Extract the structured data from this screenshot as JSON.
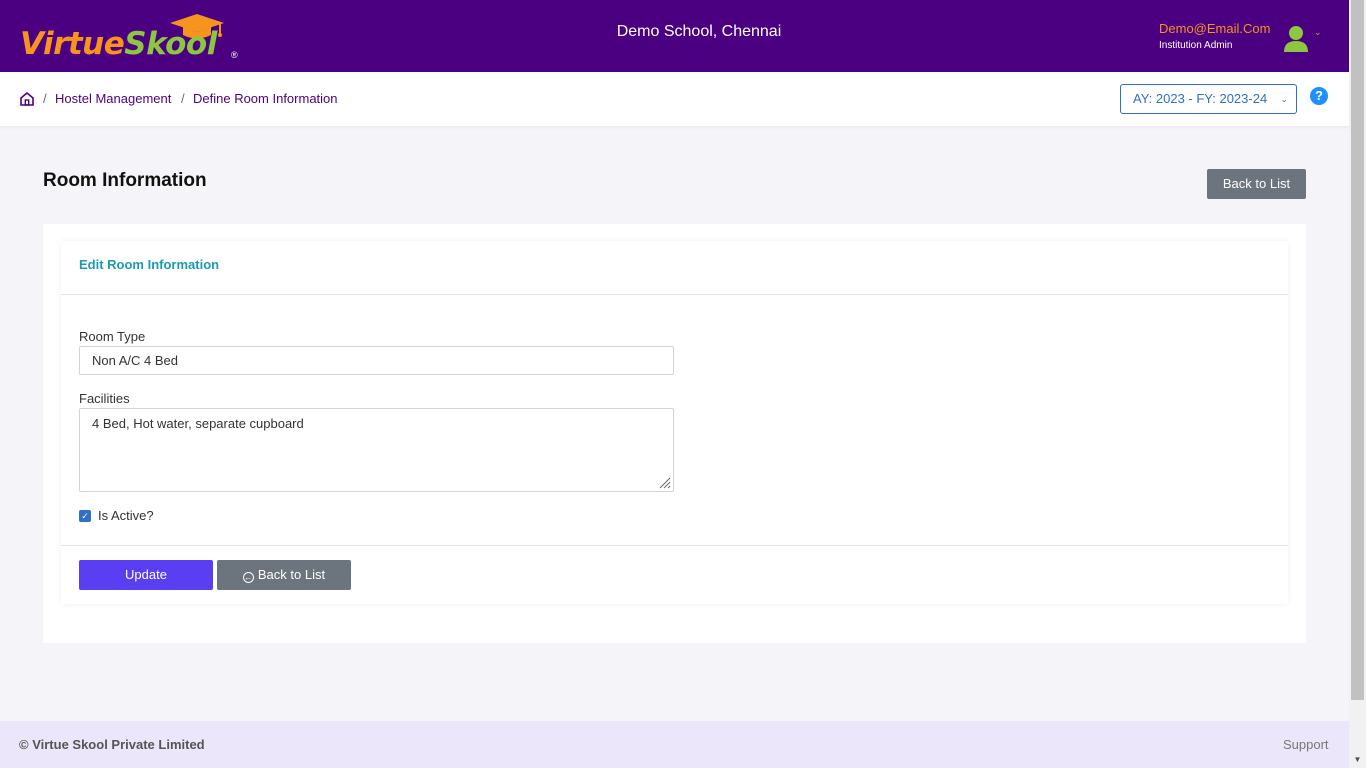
{
  "header": {
    "logo_virtue": "Virtue",
    "logo_skool": "Skool",
    "logo_reg": "®",
    "school_name": "Demo School, Chennai",
    "user_email": "Demo@Email.Com",
    "user_role": "Institution Admin",
    "user_caret": "⌄",
    "bg_color": "#4b0082"
  },
  "breadcrumb": {
    "separator": "/",
    "items": [
      "Hostel Management",
      "Define Room Information"
    ]
  },
  "academic_year": {
    "label": "AY: 2023 - FY: 2023-24",
    "caret": "⌄"
  },
  "help": {
    "label": "?"
  },
  "page": {
    "title": "Room Information",
    "back_button": "Back to List"
  },
  "form": {
    "card_title": "Edit Room Information",
    "room_type_label": "Room Type",
    "room_type_value": "Non A/C 4 Bed",
    "facilities_label": "Facilities",
    "facilities_value": "4 Bed, Hot water, separate cupboard",
    "is_active_label": "Is Active?",
    "is_active_checked": true,
    "check_mark": "✓",
    "update_button": "Update",
    "back_button": "Back to List",
    "back_icon": "←"
  },
  "footer": {
    "copyright": "© Virtue Skool Private Limited",
    "support": "Support"
  },
  "colors": {
    "accent": "#5a3ff2",
    "secondary": "#6c757d",
    "card_title": "#1a9bb0",
    "logo_orange": "#f7941d",
    "logo_green": "#8dc63f"
  }
}
